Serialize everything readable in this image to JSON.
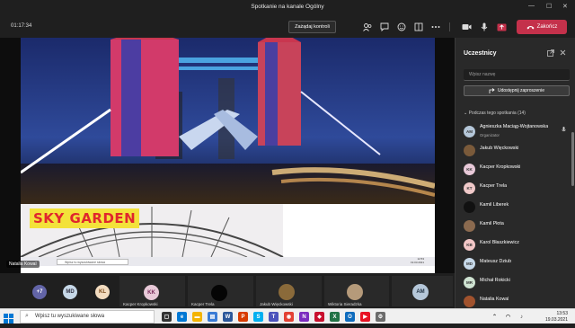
{
  "titlebar": {
    "title": "Spotkanie na kanale Ogólny",
    "minimize": "—",
    "maximize": "☐",
    "close": "✕"
  },
  "toolbar": {
    "timer": "01:17:34",
    "control_label": "Zażądaj kontroli",
    "end_call_label": "Zakończ"
  },
  "stage": {
    "presenter_name": "Natalia Kowal",
    "slide_label": "SKY GARDEN",
    "mini_search": "Wpisz tu wyszukiwane słowa",
    "mini_time": "12:53",
    "mini_date": "19.03.2021"
  },
  "gallery": {
    "overflow_count": "+7",
    "tiles": [
      {
        "initials": "MD",
        "name": ""
      },
      {
        "initials": "KL",
        "name": ""
      },
      {
        "initials": "KK",
        "name": "Kacper Kropkowski"
      },
      {
        "initials": "",
        "name": "Kacper Trela"
      },
      {
        "initials": "",
        "name": "Jakub Więckowski"
      },
      {
        "initials": "",
        "name": "Wiktoria Sieradzka"
      },
      {
        "initials": "AM",
        "name": ""
      }
    ]
  },
  "panel": {
    "title": "Uczestnicy",
    "search_placeholder": "Wpisz nazwę",
    "invite_label": "Udostępnij zaproszenie",
    "section_label": "Podczas tego spotkania (14)",
    "participants": [
      {
        "initials": "AM",
        "name": "Agnieszka Maciąg-Wojtanowska",
        "role": "Organizator",
        "color": "#b5c7d9"
      },
      {
        "initials": "",
        "name": "Jakub Więckowski",
        "role": "",
        "color": "#7a5a3a"
      },
      {
        "initials": "KK",
        "name": "Kacper Kropkowski",
        "role": "",
        "color": "#e8c9d8"
      },
      {
        "initials": "KT",
        "name": "Kacper Trela",
        "role": "",
        "color": "#f0c9c9"
      },
      {
        "initials": "",
        "name": "Kamil Liberek",
        "role": "",
        "color": "#111111"
      },
      {
        "initials": "",
        "name": "Kamil Płota",
        "role": "",
        "color": "#8b6a4f"
      },
      {
        "initials": "KB",
        "name": "Karol Błaszkiewicz",
        "role": "",
        "color": "#f2c6c6"
      },
      {
        "initials": "MD",
        "name": "Mateusz Dziub",
        "role": "",
        "color": "#c6d8e8"
      },
      {
        "initials": "MR",
        "name": "Michał Rokicki",
        "role": "",
        "color": "#cfe3d2"
      },
      {
        "initials": "",
        "name": "Natalia Kowal",
        "role": "",
        "color": "#a0522d"
      }
    ]
  },
  "taskbar": {
    "search_placeholder": "Wpisz tu wyszukiwane słowa",
    "time": "13:53",
    "date": "19.03.2021"
  }
}
